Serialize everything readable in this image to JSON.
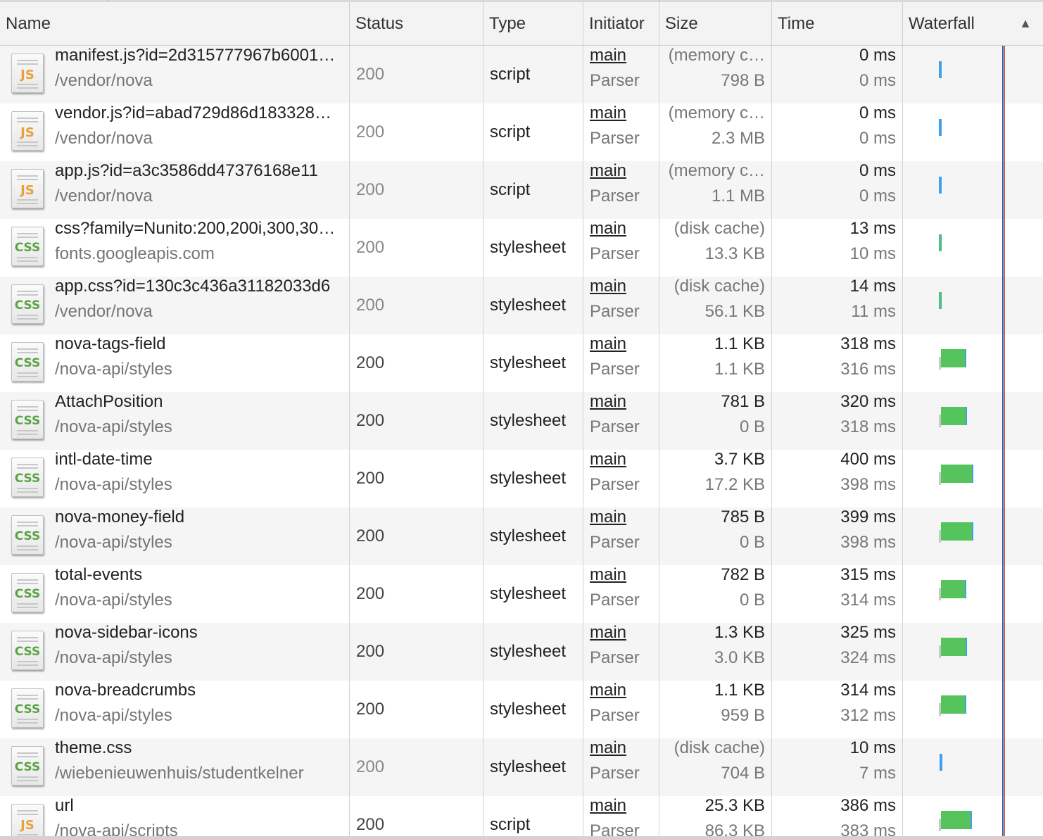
{
  "columns": [
    {
      "key": "name",
      "label": "Name"
    },
    {
      "key": "status",
      "label": "Status"
    },
    {
      "key": "type",
      "label": "Type"
    },
    {
      "key": "initiator",
      "label": "Initiator"
    },
    {
      "key": "size",
      "label": "Size"
    },
    {
      "key": "time",
      "label": "Time"
    },
    {
      "key": "waterfall",
      "label": "Waterfall",
      "sort_icon": "▲"
    }
  ],
  "colors": {
    "waterfall_receive": "#55c45c",
    "waterfall_send": "#3fa0ee",
    "waterfall_waiting": "#c8c8c8",
    "dom_content_loaded_marker": "#3b57a8",
    "load_marker": "#c0392b",
    "js_icon_label": "#e6a13b",
    "css_icon_label": "#5aa344"
  },
  "requests": [
    {
      "icon": "js-file-icon",
      "icon_label": "JS",
      "name": "manifest.js?id=2d315777967b6001…",
      "path": "/vendor/nova",
      "status": "200",
      "status_dim": true,
      "type": "script",
      "initiator": "main",
      "initiator_detail": "Parser",
      "size": "(memory c…",
      "size_detail": "798 B",
      "size_cached": true,
      "time": "0 ms",
      "latency": "0 ms",
      "wf_start_ms": 0,
      "wf_wait_ms": 0,
      "wf_duration_ms": 0
    },
    {
      "icon": "js-file-icon",
      "icon_label": "JS",
      "name": "vendor.js?id=abad729d86d183328…",
      "path": "/vendor/nova",
      "status": "200",
      "status_dim": true,
      "type": "script",
      "initiator": "main",
      "initiator_detail": "Parser",
      "size": "(memory c…",
      "size_detail": "2.3 MB",
      "size_cached": true,
      "time": "0 ms",
      "latency": "0 ms",
      "wf_start_ms": 0,
      "wf_wait_ms": 0,
      "wf_duration_ms": 0
    },
    {
      "icon": "js-file-icon",
      "icon_label": "JS",
      "name": "app.js?id=a3c3586dd47376168e11",
      "path": "/vendor/nova",
      "status": "200",
      "status_dim": true,
      "type": "script",
      "initiator": "main",
      "initiator_detail": "Parser",
      "size": "(memory c…",
      "size_detail": "1.1 MB",
      "size_cached": true,
      "time": "0 ms",
      "latency": "0 ms",
      "wf_start_ms": 0,
      "wf_wait_ms": 0,
      "wf_duration_ms": 0
    },
    {
      "icon": "css-file-icon",
      "icon_label": "CSS",
      "name": "css?family=Nunito:200,200i,300,30…",
      "path": "fonts.googleapis.com",
      "status": "200",
      "status_dim": true,
      "type": "stylesheet",
      "initiator": "main",
      "initiator_detail": "Parser",
      "size": "(disk cache)",
      "size_detail": "13.3 KB",
      "size_cached": true,
      "time": "13 ms",
      "latency": "10 ms",
      "wf_start_ms": 0,
      "wf_wait_ms": 0,
      "wf_duration_ms": 13
    },
    {
      "icon": "css-file-icon",
      "icon_label": "CSS",
      "name": "app.css?id=130c3c436a31182033d6",
      "path": "/vendor/nova",
      "status": "200",
      "status_dim": true,
      "type": "stylesheet",
      "initiator": "main",
      "initiator_detail": "Parser",
      "size": "(disk cache)",
      "size_detail": "56.1 KB",
      "size_cached": true,
      "time": "14 ms",
      "latency": "11 ms",
      "wf_start_ms": 0,
      "wf_wait_ms": 0,
      "wf_duration_ms": 14
    },
    {
      "icon": "css-file-icon",
      "icon_label": "CSS",
      "name": "nova-tags-field",
      "path": "/nova-api/styles",
      "status": "200",
      "status_dim": false,
      "type": "stylesheet",
      "initiator": "main",
      "initiator_detail": "Parser",
      "size": "1.1 KB",
      "size_detail": "1.1 KB",
      "size_cached": false,
      "time": "318 ms",
      "latency": "316 ms",
      "wf_start_ms": 0,
      "wf_wait_ms": 20,
      "wf_duration_ms": 318
    },
    {
      "icon": "css-file-icon",
      "icon_label": "CSS",
      "name": "AttachPosition",
      "path": "/nova-api/styles",
      "status": "200",
      "status_dim": false,
      "type": "stylesheet",
      "initiator": "main",
      "initiator_detail": "Parser",
      "size": "781 B",
      "size_detail": "0 B",
      "size_cached": false,
      "time": "320 ms",
      "latency": "318 ms",
      "wf_start_ms": 0,
      "wf_wait_ms": 20,
      "wf_duration_ms": 320
    },
    {
      "icon": "css-file-icon",
      "icon_label": "CSS",
      "name": "intl-date-time",
      "path": "/nova-api/styles",
      "status": "200",
      "status_dim": false,
      "type": "stylesheet",
      "initiator": "main",
      "initiator_detail": "Parser",
      "size": "3.7 KB",
      "size_detail": "17.2 KB",
      "size_cached": false,
      "time": "400 ms",
      "latency": "398 ms",
      "wf_start_ms": 0,
      "wf_wait_ms": 20,
      "wf_duration_ms": 400
    },
    {
      "icon": "css-file-icon",
      "icon_label": "CSS",
      "name": "nova-money-field",
      "path": "/nova-api/styles",
      "status": "200",
      "status_dim": false,
      "type": "stylesheet",
      "initiator": "main",
      "initiator_detail": "Parser",
      "size": "785 B",
      "size_detail": "0 B",
      "size_cached": false,
      "time": "399 ms",
      "latency": "398 ms",
      "wf_start_ms": 0,
      "wf_wait_ms": 20,
      "wf_duration_ms": 399
    },
    {
      "icon": "css-file-icon",
      "icon_label": "CSS",
      "name": "total-events",
      "path": "/nova-api/styles",
      "status": "200",
      "status_dim": false,
      "type": "stylesheet",
      "initiator": "main",
      "initiator_detail": "Parser",
      "size": "782 B",
      "size_detail": "0 B",
      "size_cached": false,
      "time": "315 ms",
      "latency": "314 ms",
      "wf_start_ms": 0,
      "wf_wait_ms": 20,
      "wf_duration_ms": 315
    },
    {
      "icon": "css-file-icon",
      "icon_label": "CSS",
      "name": "nova-sidebar-icons",
      "path": "/nova-api/styles",
      "status": "200",
      "status_dim": false,
      "type": "stylesheet",
      "initiator": "main",
      "initiator_detail": "Parser",
      "size": "1.3 KB",
      "size_detail": "3.0 KB",
      "size_cached": false,
      "time": "325 ms",
      "latency": "324 ms",
      "wf_start_ms": 0,
      "wf_wait_ms": 20,
      "wf_duration_ms": 325
    },
    {
      "icon": "css-file-icon",
      "icon_label": "CSS",
      "name": "nova-breadcrumbs",
      "path": "/nova-api/styles",
      "status": "200",
      "status_dim": false,
      "type": "stylesheet",
      "initiator": "main",
      "initiator_detail": "Parser",
      "size": "1.1 KB",
      "size_detail": "959 B",
      "size_cached": false,
      "time": "314 ms",
      "latency": "312 ms",
      "wf_start_ms": 0,
      "wf_wait_ms": 20,
      "wf_duration_ms": 314
    },
    {
      "icon": "css-file-icon",
      "icon_label": "CSS",
      "name": "theme.css",
      "path": "/wiebenieuwenhuis/studentkelner",
      "status": "200",
      "status_dim": true,
      "type": "stylesheet",
      "initiator": "main",
      "initiator_detail": "Parser",
      "size": "(disk cache)",
      "size_detail": "704 B",
      "size_cached": true,
      "time": "10 ms",
      "latency": "7 ms",
      "wf_start_ms": 10,
      "wf_wait_ms": 0,
      "wf_duration_ms": 10
    },
    {
      "icon": "js-file-icon",
      "icon_label": "JS",
      "name": "url",
      "path": "/nova-api/scripts",
      "status": "200",
      "status_dim": false,
      "type": "script",
      "initiator": "main",
      "initiator_detail": "Parser",
      "size": "25.3 KB",
      "size_detail": "86.3 KB",
      "size_cached": false,
      "time": "386 ms",
      "latency": "383 ms",
      "wf_start_ms": 0,
      "wf_wait_ms": 20,
      "wf_duration_ms": 386
    }
  ]
}
